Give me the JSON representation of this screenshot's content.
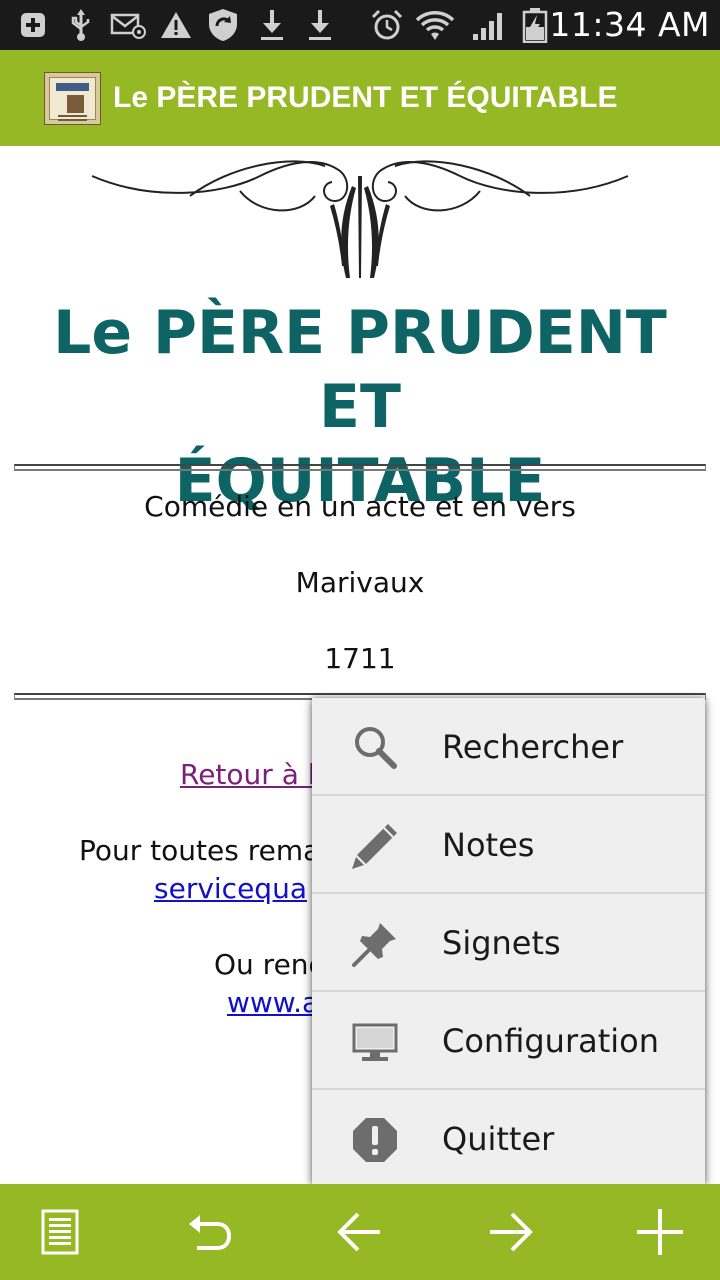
{
  "status_bar": {
    "time": "11:34 AM"
  },
  "action_bar": {
    "title": "Le PÈRE PRUDENT ET ÉQUITABLE",
    "logo_text": "MARIVAUX"
  },
  "content": {
    "title_line1": "Le PÈRE PRUDENT ET",
    "title_line2": "ÉQUITABLE",
    "subtitle": "Comédie en un acte et en vers",
    "author": "Marivaux",
    "year": "1711",
    "retour_link_visible": "Retour à l",
    "remarks_visible": "Pour toutes rema",
    "email_visible": "servicequa",
    "ou_visible": "Ou renc",
    "www_visible": "www.a"
  },
  "menu": {
    "items": [
      {
        "label": "Rechercher",
        "icon": "search-icon"
      },
      {
        "label": "Notes",
        "icon": "pencil-icon"
      },
      {
        "label": "Signets",
        "icon": "pushpin-icon"
      },
      {
        "label": "Configuration",
        "icon": "monitor-icon"
      },
      {
        "label": "Quitter",
        "icon": "exclamation-icon"
      }
    ]
  },
  "bottom_bar": {
    "buttons": [
      "list-icon",
      "undo-icon",
      "arrow-left-icon",
      "arrow-right-icon",
      "plus-icon"
    ]
  },
  "colors": {
    "accent_green": "#95b824",
    "title_teal": "#0e6464",
    "visited_link": "#7a1f7a",
    "link_blue": "#1010c8"
  }
}
